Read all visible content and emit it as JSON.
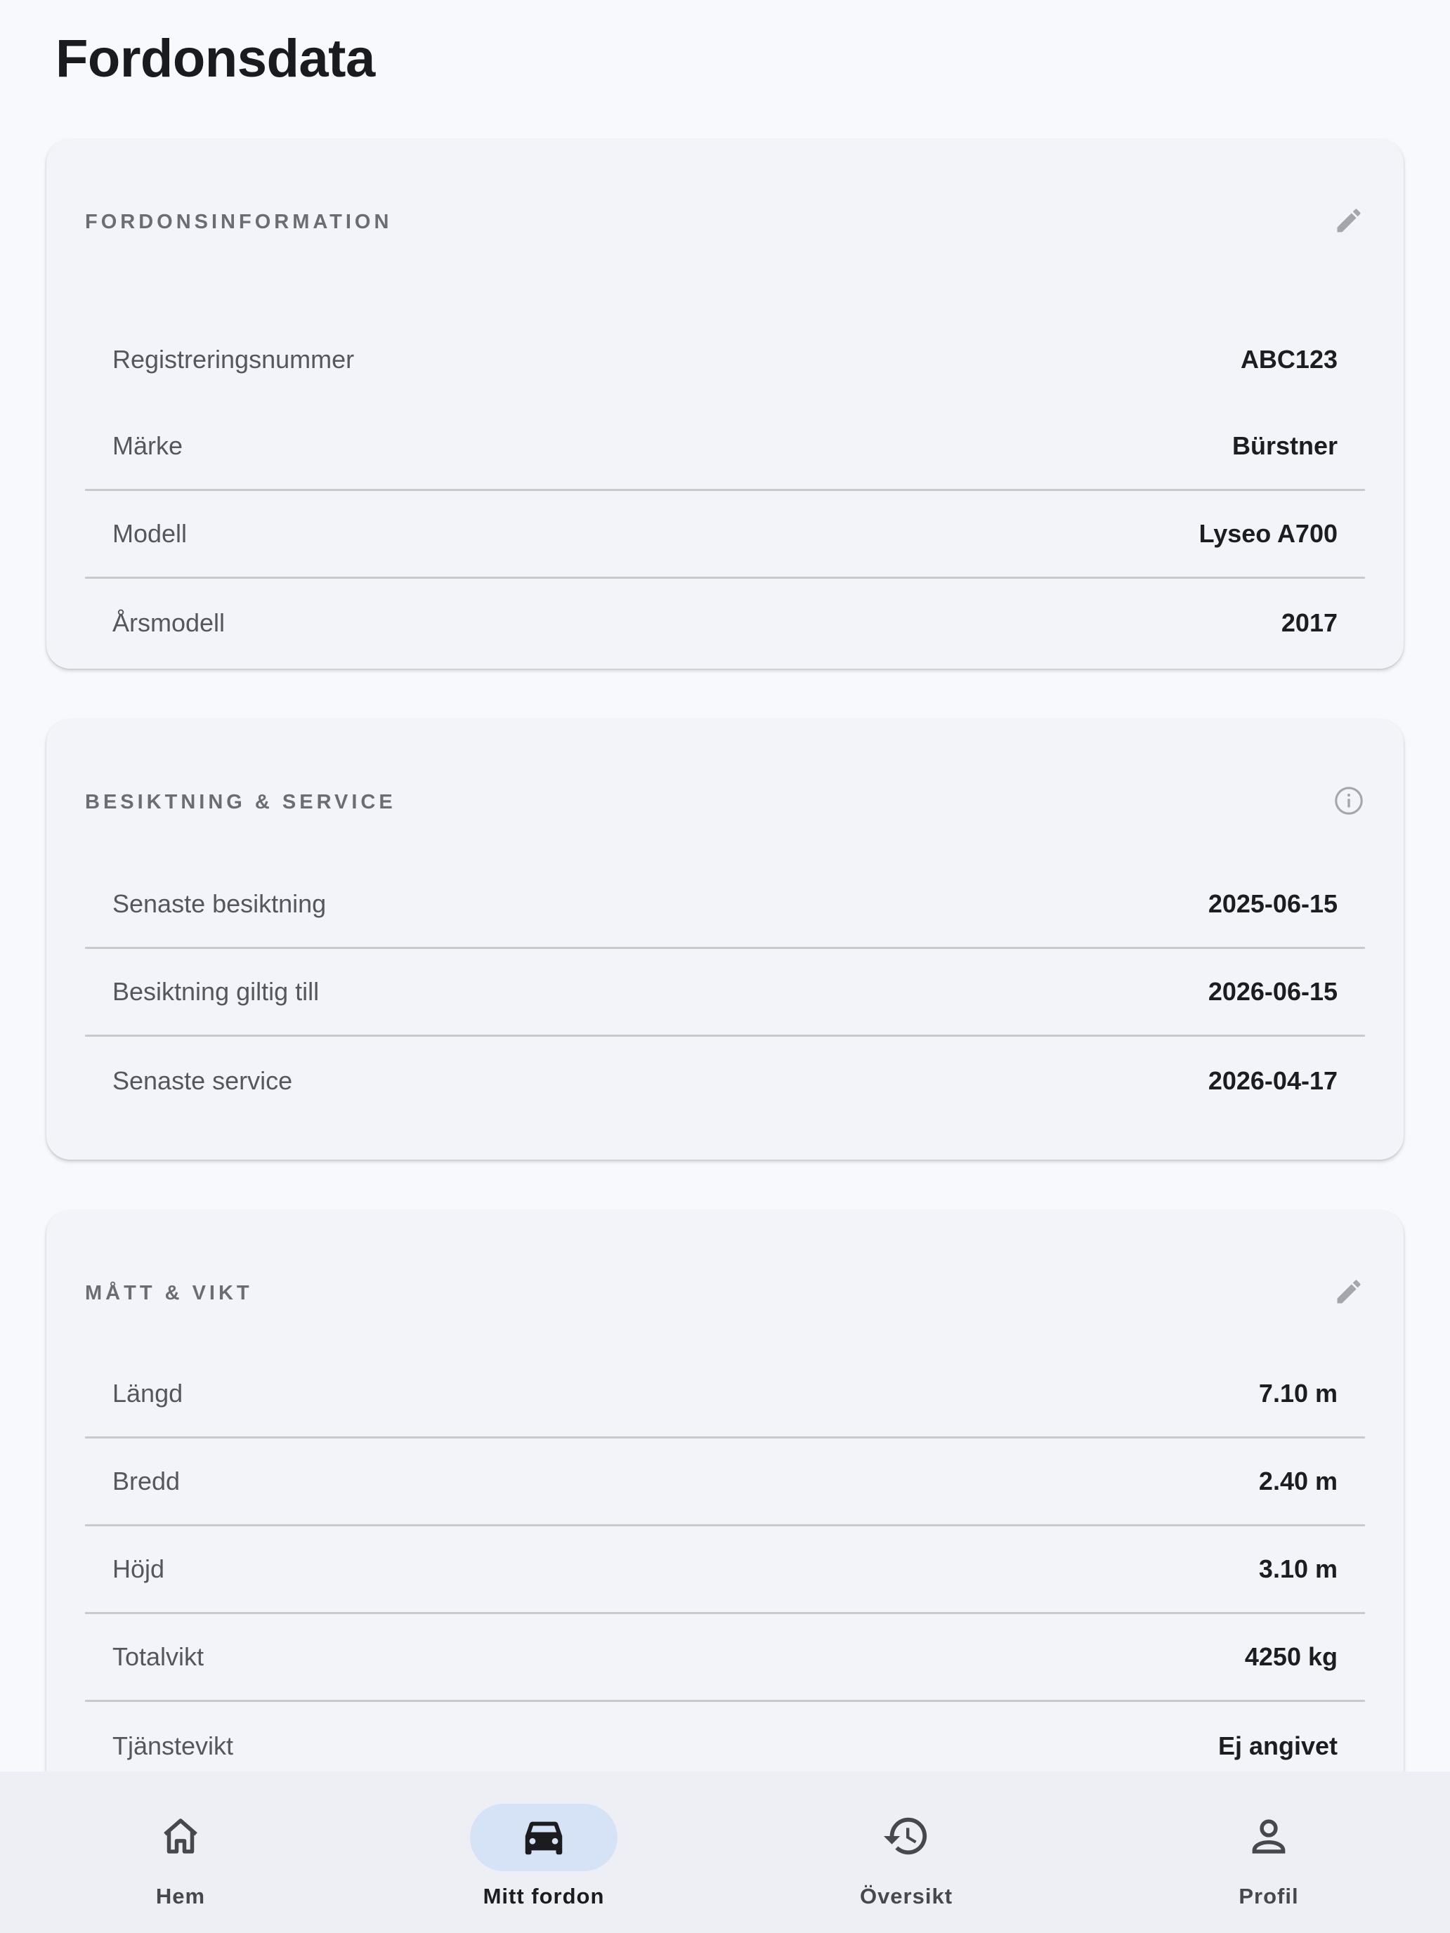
{
  "page": {
    "title": "Fordonsdata"
  },
  "sections": [
    {
      "title": "FORDONSINFORMATION",
      "action_icon": "pencil-icon",
      "rows": [
        {
          "label": "Registreringsnummer",
          "value": "ABC123"
        },
        {
          "label": "Märke",
          "value": "Bürstner"
        },
        {
          "label": "Modell",
          "value": "Lyseo A700"
        },
        {
          "label": "Årsmodell",
          "value": "2017"
        }
      ]
    },
    {
      "title": "BESIKTNING & SERVICE",
      "action_icon": "info-icon",
      "rows": [
        {
          "label": "Senaste besiktning",
          "value": "2025-06-15"
        },
        {
          "label": "Besiktning giltig till",
          "value": "2026-06-15"
        },
        {
          "label": "Senaste service",
          "value": "2026-04-17"
        }
      ]
    },
    {
      "title": "MÅTT & VIKT",
      "action_icon": "pencil-icon",
      "rows": [
        {
          "label": "Längd",
          "value": "7.10 m"
        },
        {
          "label": "Bredd",
          "value": "2.40 m"
        },
        {
          "label": "Höjd",
          "value": "3.10 m"
        },
        {
          "label": "Totalvikt",
          "value": "4250 kg"
        },
        {
          "label": "Tjänstevikt",
          "value": "Ej angivet"
        }
      ]
    }
  ],
  "nav": {
    "active": "Mitt fordon",
    "items": [
      {
        "label": "Hem",
        "icon": "home-icon"
      },
      {
        "label": "Mitt fordon",
        "icon": "car-icon"
      },
      {
        "label": "Översikt",
        "icon": "history-icon"
      },
      {
        "label": "Profil",
        "icon": "person-icon"
      }
    ]
  },
  "colors": {
    "background": "#f8f9fd",
    "card": "#f3f4f9",
    "nav_background": "#eeeff4",
    "active_pill": "#d6e3f7",
    "divider": "#c9cace"
  }
}
